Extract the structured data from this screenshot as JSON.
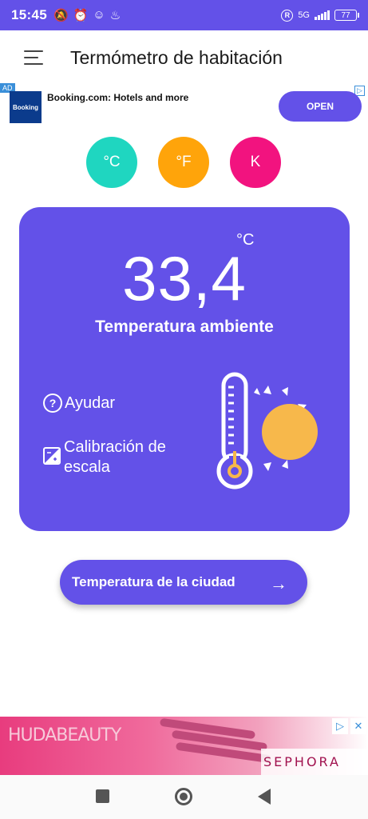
{
  "status_bar": {
    "time": "15:45",
    "network": "5G",
    "battery": "77"
  },
  "app_bar": {
    "title": "Termómetro de habitación"
  },
  "ad_top": {
    "tag": "AD",
    "logo_text": "Booking",
    "text": "Booking.com: Hotels and more",
    "cta": "OPEN"
  },
  "units": [
    {
      "label": "°C",
      "color": "#1fd6c0"
    },
    {
      "label": "°F",
      "color": "#ffa40a"
    },
    {
      "label": "K",
      "color": "#f2137f"
    }
  ],
  "reading": {
    "value": "33,4",
    "unit": "°C",
    "label": "Temperatura ambiente"
  },
  "actions": {
    "help": "Ayudar",
    "calibration": "Calibración de escala"
  },
  "city_button": {
    "label": "Temperatura de la ciudad"
  },
  "ad_bottom": {
    "brand": "HUDABEAUTY",
    "retailer": "SEPHORA"
  },
  "colors": {
    "primary": "#6351e8",
    "sun": "#f7b84b",
    "celsius": "#1fd6c0",
    "fahrenheit": "#ffa40a",
    "kelvin": "#f2137f"
  }
}
